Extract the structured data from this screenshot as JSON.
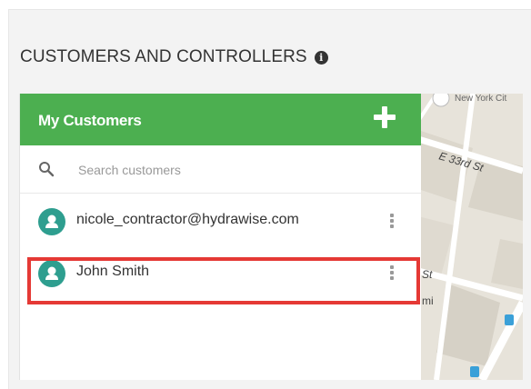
{
  "header": {
    "title": "CUSTOMERS AND CONTROLLERS",
    "info_icon": "info-circle-icon"
  },
  "panel": {
    "title": "My Customers",
    "add_icon": "plus-icon",
    "brand_color": "#4caf50"
  },
  "search": {
    "placeholder": "Search customers",
    "value": "",
    "icon": "search-icon"
  },
  "customers": [
    {
      "label": "nicole_contractor@hydrawise.com",
      "avatar_icon": "user-icon",
      "menu_icon": "vertical-ellipsis-icon"
    },
    {
      "label": "John Smith",
      "avatar_icon": "user-icon",
      "menu_icon": "vertical-ellipsis-icon",
      "highlighted": true
    }
  ],
  "map": {
    "street_labels": [
      "New York Cit",
      "E 33rd St",
      "St",
      "mi"
    ]
  },
  "highlight_color": "#e53935"
}
